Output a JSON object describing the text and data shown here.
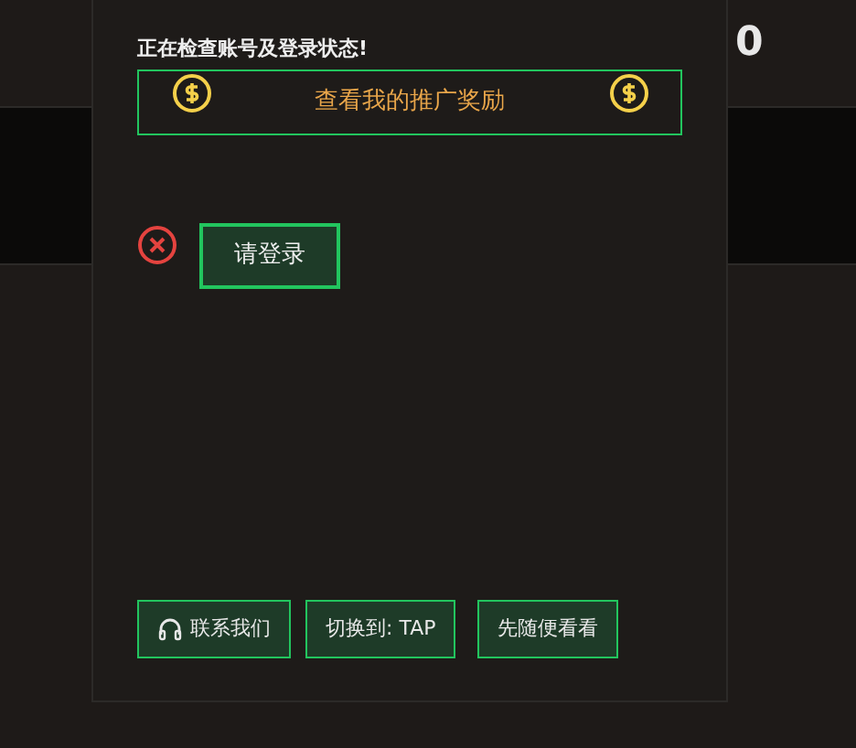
{
  "corner_value": "0",
  "status_title": "正在检查账号及登录状态!",
  "promo_link": "查看我的推广奖励",
  "login_button": "请登录",
  "footer_buttons": [
    {
      "kind": "contact",
      "label": "联系我们"
    },
    {
      "kind": "plain",
      "label": "切换到: TAP"
    },
    {
      "kind": "plain",
      "label": "先随便看看"
    }
  ]
}
